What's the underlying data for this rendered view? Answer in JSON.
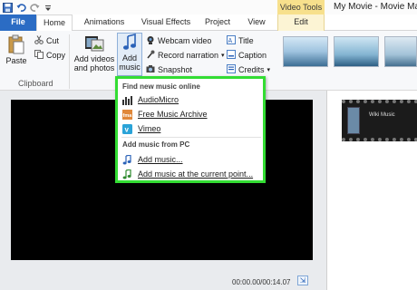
{
  "title_bar": {
    "context_tab_label": "Video Tools",
    "window_title": "My Movie - Movie Make",
    "qat_icons": [
      "save-icon",
      "undo-icon",
      "redo-icon",
      "customize-icon"
    ]
  },
  "tabs": [
    {
      "label": "File"
    },
    {
      "label": "Home"
    },
    {
      "label": "Animations"
    },
    {
      "label": "Visual Effects"
    },
    {
      "label": "Project"
    },
    {
      "label": "View"
    },
    {
      "label": "Edit"
    }
  ],
  "ribbon": {
    "clipboard": {
      "paste": "Paste",
      "cut": "Cut",
      "copy": "Copy",
      "group_label": "Clipboard"
    },
    "add_videos_label": "Add videos and photos",
    "add_music_label": "Add music",
    "webcam_video": "Webcam video",
    "record_narration": "Record narration",
    "snapshot": "Snapshot",
    "title": "Title",
    "caption": "Caption",
    "credits": "Credits"
  },
  "menu": {
    "online_header": "Find new music online",
    "online_items": [
      {
        "label": "AudioMicro",
        "icon": "audiomicro-icon"
      },
      {
        "label": "Free Music Archive",
        "icon": "free-music-archive-icon"
      },
      {
        "label": "Vimeo",
        "icon": "vimeo-icon"
      }
    ],
    "pc_header": "Add music from PC",
    "pc_items": [
      {
        "label": "Add music...",
        "icon": "music-note-icon"
      },
      {
        "label": "Add music at the current point...",
        "icon": "music-note-plus-icon"
      }
    ],
    "highlight_color": "#33dd33"
  },
  "preview": {
    "timecode": "00:00.00/00:14.07"
  },
  "storyboard": {
    "clip_label": "Wiki Music"
  },
  "colors": {
    "file_tab": "#2b6cc4",
    "context_tab": "#f7e08c",
    "preview_bg": "#000000",
    "menu_border": "#33dd33"
  }
}
